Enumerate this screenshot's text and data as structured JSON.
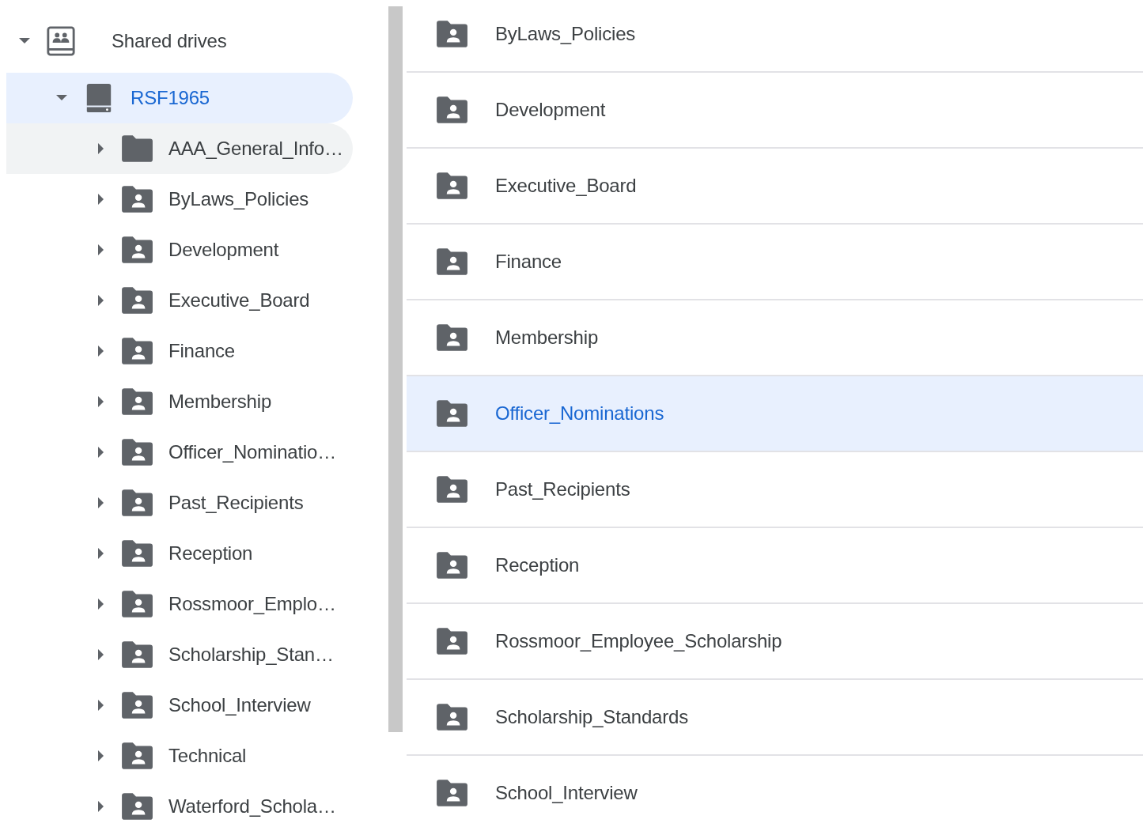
{
  "tree": {
    "label": "Shared drives",
    "expanded": true,
    "children": [
      {
        "label": "RSF1965",
        "selected": true,
        "expanded": true,
        "children": [
          {
            "label": "AAA_General_Info…",
            "kind": "folder",
            "hovered": true,
            "expanded": false
          },
          {
            "label": "ByLaws_Policies",
            "kind": "shared-folder",
            "hovered": false,
            "expanded": false
          },
          {
            "label": "Development",
            "kind": "shared-folder",
            "hovered": false,
            "expanded": false
          },
          {
            "label": "Executive_Board",
            "kind": "shared-folder",
            "hovered": false,
            "expanded": false
          },
          {
            "label": "Finance",
            "kind": "shared-folder",
            "hovered": false,
            "expanded": false
          },
          {
            "label": "Membership",
            "kind": "shared-folder",
            "hovered": false,
            "expanded": false
          },
          {
            "label": "Officer_Nominatio…",
            "kind": "shared-folder",
            "hovered": false,
            "expanded": false
          },
          {
            "label": "Past_Recipients",
            "kind": "shared-folder",
            "hovered": false,
            "expanded": false
          },
          {
            "label": "Reception",
            "kind": "shared-folder",
            "hovered": false,
            "expanded": false
          },
          {
            "label": "Rossmoor_Emplo…",
            "kind": "shared-folder",
            "hovered": false,
            "expanded": false
          },
          {
            "label": "Scholarship_Stan…",
            "kind": "shared-folder",
            "hovered": false,
            "expanded": false
          },
          {
            "label": "School_Interview",
            "kind": "shared-folder",
            "hovered": false,
            "expanded": false
          },
          {
            "label": "Technical",
            "kind": "shared-folder",
            "hovered": false,
            "expanded": false
          },
          {
            "label": "Waterford_Schola…",
            "kind": "shared-folder",
            "hovered": false,
            "expanded": false
          }
        ]
      }
    ]
  },
  "list": [
    {
      "name": "ByLaws_Policies",
      "selected": false
    },
    {
      "name": "Development",
      "selected": false
    },
    {
      "name": "Executive_Board",
      "selected": false
    },
    {
      "name": "Finance",
      "selected": false
    },
    {
      "name": "Membership",
      "selected": false
    },
    {
      "name": "Officer_Nominations",
      "selected": true
    },
    {
      "name": "Past_Recipients",
      "selected": false
    },
    {
      "name": "Reception",
      "selected": false
    },
    {
      "name": "Rossmoor_Employee_Scholarship",
      "selected": false
    },
    {
      "name": "Scholarship_Standards",
      "selected": false
    },
    {
      "name": "School_Interview",
      "selected": false
    }
  ]
}
